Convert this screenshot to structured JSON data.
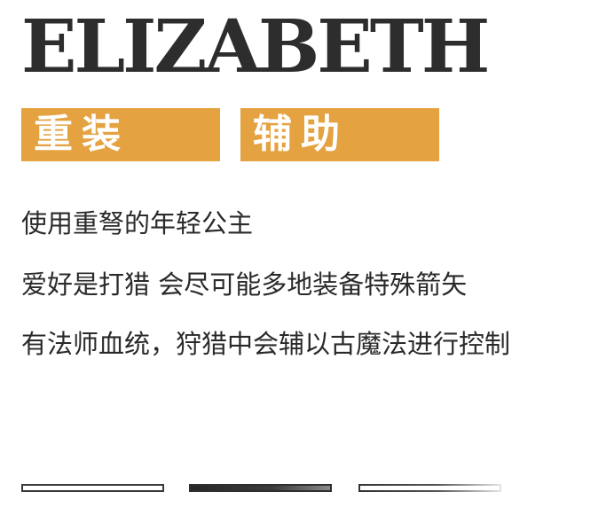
{
  "title": "ELIZABETH",
  "tags": [
    "重装",
    "辅助"
  ],
  "description": [
    "使用重弩的年轻公主",
    "爱好是打猎 会尽可能多地装备特殊箭矢",
    "有法师血统，狩猎中会辅以古魔法进行控制"
  ],
  "colors": {
    "accent": "#e4a241",
    "title": "#2d2d2d",
    "text": "#2a2a2a"
  },
  "pager": {
    "count": 3,
    "active_index": 1
  }
}
